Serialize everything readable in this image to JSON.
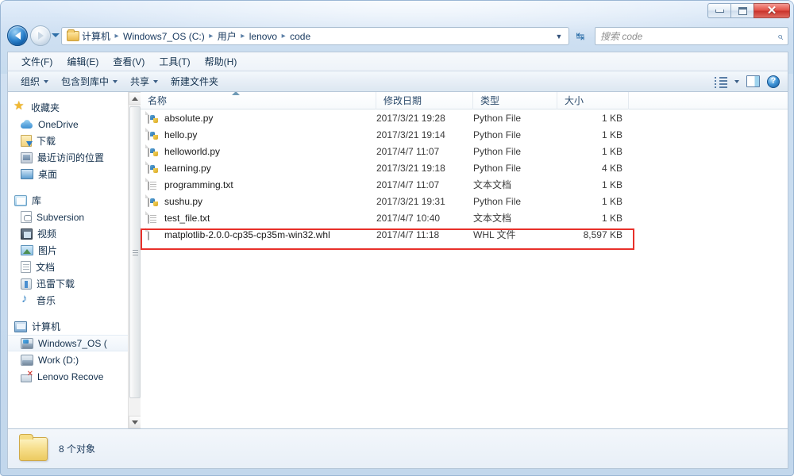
{
  "window": {
    "controls": {
      "minimize": "–",
      "maximize": "□",
      "close": "✕"
    }
  },
  "addressbar": {
    "back_icon": "back-arrow-icon",
    "forward_icon": "forward-arrow-icon",
    "recent_icon": "recent-pages-dropdown",
    "crumbs": [
      "计算机",
      "Windows7_OS (C:)",
      "用户",
      "lenovo",
      "code"
    ],
    "separator": "▶",
    "dropdown": "▼",
    "refresh_icon": "↻"
  },
  "search": {
    "placeholder": "搜索 code",
    "icon": "⌕"
  },
  "menubar": {
    "items": [
      "文件(F)",
      "编辑(E)",
      "查看(V)",
      "工具(T)",
      "帮助(H)"
    ]
  },
  "commandbar": {
    "items": [
      {
        "label": "组织",
        "has_caret": true
      },
      {
        "label": "包含到库中",
        "has_caret": true
      },
      {
        "label": "共享",
        "has_caret": true
      },
      {
        "label": "新建文件夹",
        "has_caret": false
      }
    ],
    "help_glyph": "?"
  },
  "navpane": {
    "groups": [
      {
        "header": {
          "label": "收藏夹",
          "icon": "star-icon"
        },
        "items": [
          {
            "label": "OneDrive",
            "icon": "cloud-icon"
          },
          {
            "label": "下载",
            "icon": "downloads-icon"
          },
          {
            "label": "最近访问的位置",
            "icon": "recent-places-icon"
          },
          {
            "label": "桌面",
            "icon": "desktop-icon"
          }
        ]
      },
      {
        "header": {
          "label": "库",
          "icon": "library-icon"
        },
        "items": [
          {
            "label": "Subversion",
            "icon": "subversion-icon"
          },
          {
            "label": "视频",
            "icon": "video-icon"
          },
          {
            "label": "图片",
            "icon": "pictures-icon"
          },
          {
            "label": "文档",
            "icon": "documents-icon"
          },
          {
            "label": "迅雷下载",
            "icon": "thunder-download-icon"
          },
          {
            "label": "音乐",
            "icon": "music-icon"
          }
        ]
      },
      {
        "header": {
          "label": "计算机",
          "icon": "computer-icon"
        },
        "items": [
          {
            "label": "Windows7_OS (",
            "icon": "harddisk-windows-icon",
            "selected": true
          },
          {
            "label": "Work (D:)",
            "icon": "harddisk-icon"
          },
          {
            "label": "Lenovo Recove",
            "icon": "recovery-drive-icon"
          }
        ]
      }
    ]
  },
  "filelist": {
    "columns": [
      {
        "key": "name",
        "label": "名称",
        "sorted": true
      },
      {
        "key": "date",
        "label": "修改日期"
      },
      {
        "key": "type",
        "label": "类型"
      },
      {
        "key": "size",
        "label": "大小"
      }
    ],
    "rows": [
      {
        "name": "absolute.py",
        "date": "2017/3/21 19:28",
        "type": "Python File",
        "size": "1 KB",
        "icon": "python-file-icon",
        "highlighted": false
      },
      {
        "name": "hello.py",
        "date": "2017/3/21 19:14",
        "type": "Python File",
        "size": "1 KB",
        "icon": "python-file-icon",
        "highlighted": false
      },
      {
        "name": "helloworld.py",
        "date": "2017/4/7 11:07",
        "type": "Python File",
        "size": "1 KB",
        "icon": "python-file-icon",
        "highlighted": false
      },
      {
        "name": "learning.py",
        "date": "2017/3/21 19:18",
        "type": "Python File",
        "size": "4 KB",
        "icon": "python-file-icon",
        "highlighted": false
      },
      {
        "name": "programming.txt",
        "date": "2017/4/7 11:07",
        "type": "文本文档",
        "size": "1 KB",
        "icon": "text-file-icon",
        "highlighted": false
      },
      {
        "name": "sushu.py",
        "date": "2017/3/21 19:31",
        "type": "Python File",
        "size": "1 KB",
        "icon": "python-file-icon",
        "highlighted": false
      },
      {
        "name": "test_file.txt",
        "date": "2017/4/7 10:40",
        "type": "文本文档",
        "size": "1 KB",
        "icon": "text-file-icon",
        "highlighted": false
      },
      {
        "name": "matplotlib-2.0.0-cp35-cp35m-win32.whl",
        "date": "2017/4/7 11:18",
        "type": "WHL 文件",
        "size": "8,597 KB",
        "icon": "whl-file-icon",
        "highlighted": true
      }
    ],
    "highlight_color": "#e8302a"
  },
  "statusbar": {
    "text": "8 个对象",
    "icon": "folder-icon"
  }
}
